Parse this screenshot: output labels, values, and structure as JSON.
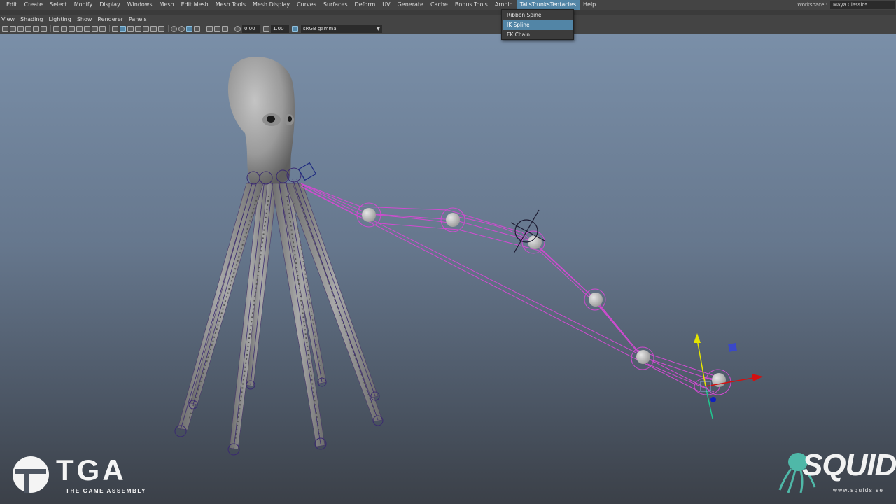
{
  "menubar": {
    "items": [
      "Edit",
      "Create",
      "Select",
      "Modify",
      "Display",
      "Windows",
      "Mesh",
      "Edit Mesh",
      "Mesh Tools",
      "Mesh Display",
      "Curves",
      "Surfaces",
      "Deform",
      "UV",
      "Generate",
      "Cache",
      "Bonus Tools",
      "Arnold",
      "TailsTrunksTentacles",
      "Help"
    ],
    "active_item": "TailsTrunksTentacles"
  },
  "workspace": {
    "label": "Workspace :",
    "value": "Maya Classic*"
  },
  "dropdown": {
    "items": [
      "Ribbon Spine",
      "IK Spline",
      "FK Chain"
    ],
    "highlighted": "IK Spline"
  },
  "panel_menu": {
    "items": [
      "View",
      "Shading",
      "Lighting",
      "Show",
      "Renderer",
      "Panels"
    ]
  },
  "toolbar": {
    "exposure": "0.00",
    "gamma": "1.00",
    "color_space": "sRGB gamma"
  },
  "branding": {
    "tga_word": "TGA",
    "tga_sub": "THE GAME ASSEMBLY",
    "squids_word": "SQUIDS",
    "squids_sub": "www.squids.se"
  },
  "colors": {
    "accent": "#5285a6",
    "rig_magenta": "#d24bd2",
    "joint_purple": "#3a2a70",
    "viewport_top": "#7a8fa8",
    "viewport_bottom": "#3b4048"
  }
}
